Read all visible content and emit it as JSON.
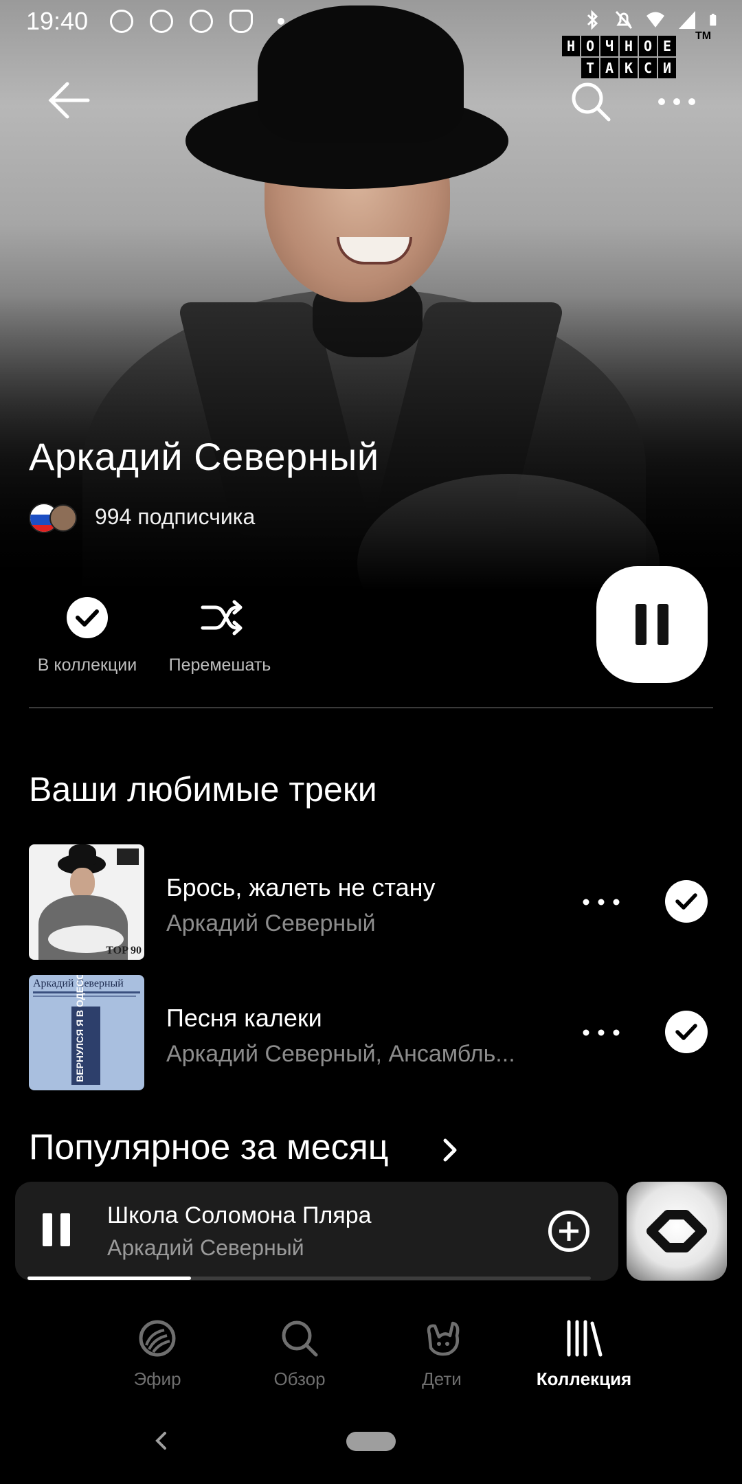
{
  "status_bar": {
    "time": "19:40",
    "icons_left": [
      "cast-icon",
      "music-icon",
      "check-circle-icon",
      "shield-icon",
      "dot-icon"
    ],
    "icons_right": [
      "bluetooth-icon",
      "bell-off-icon",
      "wifi-icon",
      "signal-icon",
      "battery-icon"
    ]
  },
  "overlay_logo": {
    "row1": [
      "Н",
      "О",
      "Ч",
      "Н",
      "О",
      "Е"
    ],
    "row2": [
      "",
      "Т",
      "А",
      "К",
      "С",
      "И"
    ],
    "tm": "TM"
  },
  "header": {
    "back_icon": "arrow-left-icon",
    "search_icon": "search-icon",
    "more_icon": "more-horizontal-icon"
  },
  "artist": {
    "name": "Аркадий Северный",
    "subscribers": "994 подписчика"
  },
  "actions": {
    "collection_label": "В коллекции",
    "shuffle_label": "Перемешать",
    "playing": true
  },
  "favorites": {
    "title": "Ваши любимые треки",
    "tracks": [
      {
        "title": "Брось, жалеть не стану",
        "artist": "Аркадий Северный",
        "cover_text": "TOP 90",
        "in_collection": true
      },
      {
        "title": "Песня калеки",
        "artist": "Аркадий Северный, Ансамбль...",
        "cover_text": "Аркадий Северный",
        "cover_subtitle": "ВЕРНУЛСЯ Я В ОДЕССУ",
        "in_collection": true
      }
    ]
  },
  "popular": {
    "title": "Популярное за месяц"
  },
  "now_playing": {
    "title": "Школа Соломона Пляра",
    "artist": "Аркадий Северный",
    "progress": 0.29
  },
  "bottom_nav": {
    "items": [
      {
        "label": "Эфир",
        "icon": "radio-waves-icon",
        "active": false
      },
      {
        "label": "Обзор",
        "icon": "search-icon",
        "active": false
      },
      {
        "label": "Дети",
        "icon": "kids-icon",
        "active": false
      },
      {
        "label": "Коллекция",
        "icon": "library-icon",
        "active": true
      }
    ]
  },
  "colors": {
    "background": "#000000",
    "primary_text": "#ffffff",
    "secondary_text": "#8c8c8c",
    "mini_player": "#1d1d1d"
  }
}
